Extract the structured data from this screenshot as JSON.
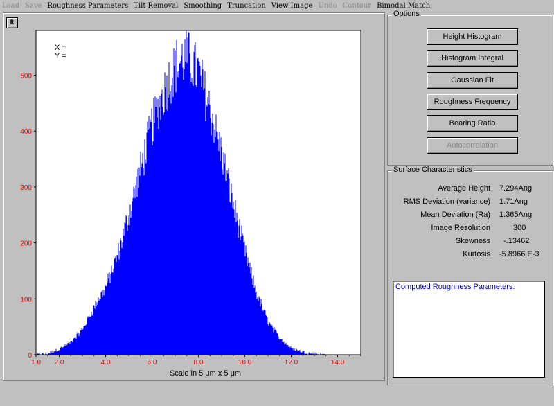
{
  "menu": [
    {
      "label": "Load",
      "enabled": false
    },
    {
      "label": "Save",
      "enabled": false
    },
    {
      "label": "Roughness Parameters",
      "enabled": true
    },
    {
      "label": "Tilt Removal",
      "enabled": true
    },
    {
      "label": "Smoothing",
      "enabled": true
    },
    {
      "label": "Truncation",
      "enabled": true
    },
    {
      "label": "View Image",
      "enabled": true
    },
    {
      "label": "Undo",
      "enabled": false
    },
    {
      "label": "Contour",
      "enabled": false
    },
    {
      "label": "Bimodal Match",
      "enabled": true
    }
  ],
  "plot": {
    "r_button": "R",
    "cursor_x_label": "X =",
    "cursor_y_label": "Y ="
  },
  "chart_data": {
    "type": "bar",
    "xlabel": "Scale in 5 μm x 5 μm",
    "ylabel": "",
    "xlim": [
      1.0,
      15.0
    ],
    "ylim": [
      0,
      580
    ],
    "x_ticks": [
      "1.0",
      "2.0",
      "4.0",
      "6.0",
      "8.0",
      "10.0",
      "12.0",
      "14.0"
    ],
    "x_tick_values": [
      1.0,
      2.0,
      4.0,
      6.0,
      8.0,
      10.0,
      12.0,
      14.0
    ],
    "y_ticks": [
      0,
      100,
      200,
      300,
      400,
      500
    ],
    "series": [
      {
        "x": [
          1.0,
          1.5,
          2.0,
          2.5,
          3.0,
          3.5,
          4.0,
          4.5,
          5.0,
          5.5,
          6.0,
          6.5,
          7.0,
          7.5,
          8.0,
          8.5,
          9.0,
          9.5,
          10.0,
          10.5,
          11.0,
          11.5,
          12.0,
          12.5,
          13.0,
          13.5,
          14.0
        ],
        "y": [
          0,
          2,
          10,
          22,
          45,
          85,
          120,
          175,
          250,
          330,
          410,
          470,
          515,
          535,
          505,
          440,
          360,
          270,
          185,
          110,
          60,
          30,
          12,
          5,
          2,
          0,
          0
        ]
      }
    ],
    "bar_color": "#0000ff",
    "tick_label_color": "#ff0000"
  },
  "options": {
    "title": "Options",
    "buttons": [
      {
        "label": "Height Histogram",
        "enabled": true
      },
      {
        "label": "Histogram Integral",
        "enabled": true
      },
      {
        "label": "Gaussian Fit",
        "enabled": true
      },
      {
        "label": "Roughness Frequency",
        "enabled": true
      },
      {
        "label": "Bearing Ratio",
        "enabled": true
      },
      {
        "label": "Autocorrelation",
        "enabled": false
      }
    ]
  },
  "surface": {
    "title": "Surface Characteristics",
    "stats": [
      {
        "label": "Average Height",
        "value": "7.294Ang"
      },
      {
        "label": "RMS Deviation (variance)",
        "value": "1.71Ang"
      },
      {
        "label": "Mean Deviation (Ra)",
        "value": "1.365Ang"
      },
      {
        "label": "Image Resolution",
        "value": "300"
      },
      {
        "label": "Skewness",
        "value": "-.13462"
      },
      {
        "label": "Kurtosis",
        "value": "-5.8966 E-3"
      }
    ],
    "computed_title": "Computed Roughness Parameters:"
  }
}
